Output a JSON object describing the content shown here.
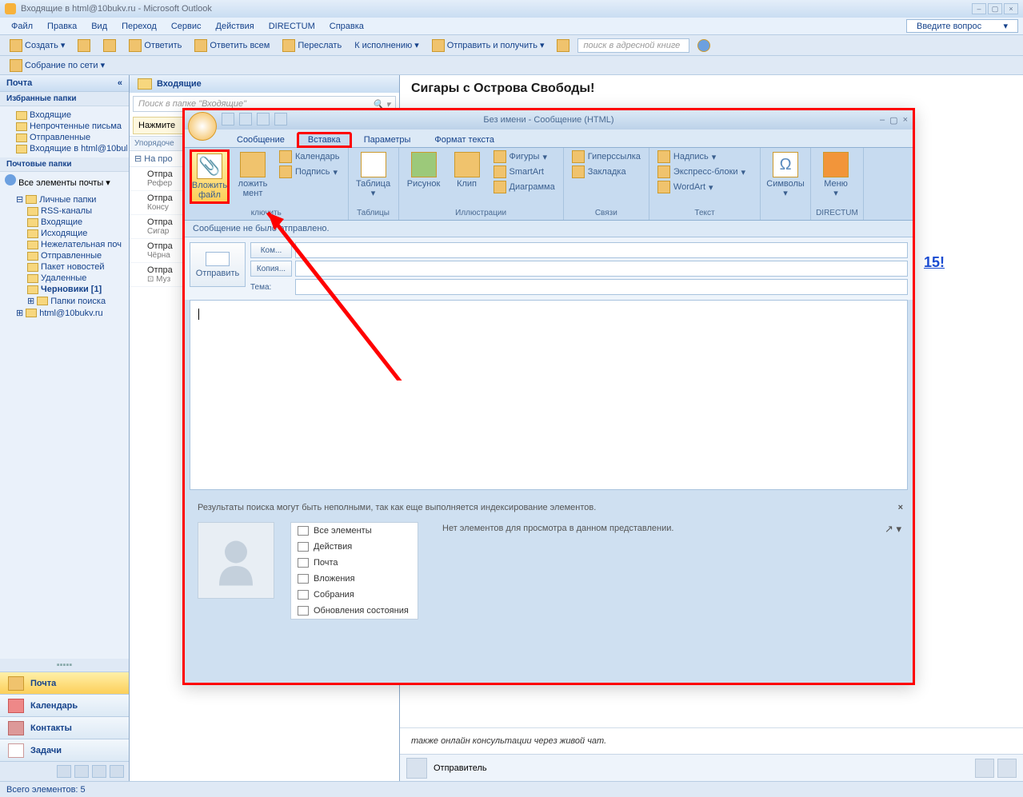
{
  "app": {
    "title": "Входящие в html@10bukv.ru - Microsoft Outlook"
  },
  "menu": {
    "file": "Файл",
    "edit": "Правка",
    "view": "Вид",
    "go": "Переход",
    "tools": "Сервис",
    "actions": "Действия",
    "directum": "DIRECTUM",
    "help": "Справка",
    "ask": "Введите вопрос"
  },
  "toolbar": {
    "create": "Создать",
    "reply": "Ответить",
    "reply_all": "Ответить всем",
    "forward": "Переслать",
    "followup": "К исполнению",
    "sendrecv": "Отправить и получить",
    "addrsearch": "поиск в адресной книге"
  },
  "toolbar2": {
    "meeting": "Собрание по сети"
  },
  "nav": {
    "mail": "Почта",
    "fav_hdr": "Избранные папки",
    "fav": [
      "Входящие",
      "Непрочтенные письма",
      "Отправленные",
      "Входящие в html@10buk"
    ],
    "mf_hdr": "Почтовые папки",
    "all": "Все элементы почты",
    "pf": "Личные папки",
    "folders": [
      "RSS-каналы",
      "Входящие",
      "Исходящие",
      "Нежелательная поч",
      "Отправленные",
      "Пакет новостей",
      "Удаленные"
    ],
    "drafts": "Черновики  [1]",
    "search": "Папки поиска",
    "acct": "html@10bukv.ru",
    "btns": {
      "mail": "Почта",
      "cal": "Календарь",
      "contacts": "Контакты",
      "tasks": "Задачи"
    }
  },
  "list": {
    "hdr": "Входящие",
    "search": "Поиск в папке \"Входящие\"",
    "info": "Нажмите",
    "sort": "Упорядоче",
    "grp": "⊟ На про",
    "items": [
      {
        "s": "Отпра",
        "p": "Рефер"
      },
      {
        "s": "Отпра",
        "p": "Консу"
      },
      {
        "s": "Отпра",
        "p": "Сигар"
      },
      {
        "s": "Отпра",
        "p": "Чёрна"
      },
      {
        "s": "Отпра",
        "p": "⊡ Муз"
      }
    ]
  },
  "read": {
    "subject": "Сигары с Острова Свободы!",
    "foot": "также онлайн консультации через живой чат.",
    "sender": "Отправитель",
    "link": "15!"
  },
  "compose": {
    "title": "Без имени - Сообщение (HTML)",
    "tabs": {
      "msg": "Сообщение",
      "insert": "Вставка",
      "options": "Параметры",
      "format": "Формат текста"
    },
    "ribbon": {
      "attach": "Вложить файл",
      "attach_item": "ложить мент",
      "include": "ключить",
      "calendar": "Календарь",
      "signature": "Подпись",
      "table": "Таблица",
      "tables": "Таблицы",
      "picture": "Рисунок",
      "clip": "Клип",
      "illus": "Иллюстрации",
      "shapes": "Фигуры",
      "smartart": "SmartArt",
      "chart": "Диаграмма",
      "hyperlink": "Гиперссылка",
      "bookmark": "Закладка",
      "links": "Связи",
      "textbox": "Надпись",
      "quickparts": "Экспресс-блоки",
      "wordart": "WordArt",
      "text": "Текст",
      "symbols": "Символы",
      "directum": "Меню",
      "directum_grp": "DIRECTUM"
    },
    "notsent": "Сообщение не было отправлено.",
    "send": "Отправить",
    "to": "Ком...",
    "cc": "Копия...",
    "subj": "Тема:",
    "searchres": "Результаты поиска могут быть неполными, так как еще выполняется индексирование элементов.",
    "noitems": "Нет элементов для просмотра в данном представлении.",
    "people": [
      "Все элементы",
      "Действия",
      "Почта",
      "Вложения",
      "Собрания",
      "Обновления состояния"
    ]
  },
  "status": {
    "count": "Всего элементов: 5"
  }
}
